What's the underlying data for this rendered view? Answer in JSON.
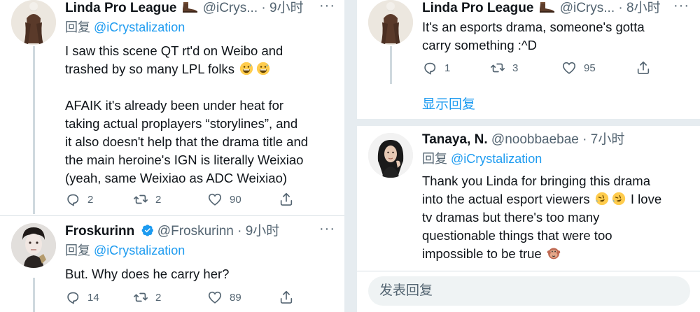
{
  "left": {
    "tweet1": {
      "name": "Linda Pro League",
      "handle": "@iCrys...",
      "dot": "·",
      "time": "9小时",
      "reply_prefix": "回复",
      "reply_mention": "@iCrystalization",
      "lines_a": [
        "I saw this scene QT rt'd on Weibo and",
        "trashed by so many LPL folks"
      ],
      "lines_b": [
        "AFAIK it's already been under heat for",
        "taking actual proplayers “storylines”, and",
        "it also doesn't help that the drama title and",
        "the main heroine's IGN is literally Weixiao",
        "(yeah, same Weixiao as ADC Weixiao)"
      ],
      "replies": "2",
      "retweets": "2",
      "likes": "90"
    },
    "tweet2": {
      "name": "Froskurinn",
      "handle": "@Froskurinn",
      "dot": "·",
      "time": "9小时",
      "reply_prefix": "回复",
      "reply_mention": "@iCrystalization",
      "text": "But. Why does he carry her?",
      "replies": "14",
      "retweets": "2",
      "likes": "89"
    }
  },
  "right": {
    "tweet1": {
      "name": "Linda Pro League",
      "handle": "@iCrys...",
      "dot": "·",
      "time": "8小时",
      "lines": [
        "It's an esports drama, someone's gotta",
        "carry something :^D"
      ],
      "replies": "1",
      "retweets": "3",
      "likes": "95"
    },
    "show_replies": "显示回复",
    "tweet2": {
      "name": "Tanaya, N.",
      "handle": "@noobbaebae",
      "dot": "·",
      "time": "7小时",
      "reply_prefix": "回复",
      "reply_mention": "@iCrystalization",
      "line1": "Thank you Linda for bringing this drama",
      "line2_pre": "into the actual esport viewers",
      "line2_post": "I love",
      "line3": "tv dramas but there's too many",
      "line4": "questionable things that were too",
      "line5": "impossible to be true"
    },
    "reply_placeholder": "发表回复"
  },
  "icons": {
    "reply": "reply-icon",
    "retweet": "retweet-icon",
    "like": "heart-icon",
    "share": "share-icon",
    "verified": "verified-badge-icon",
    "more": "more-icon"
  },
  "colors": {
    "accent": "#1d9bf0",
    "muted": "#536471",
    "separator": "#e6ecf0"
  }
}
